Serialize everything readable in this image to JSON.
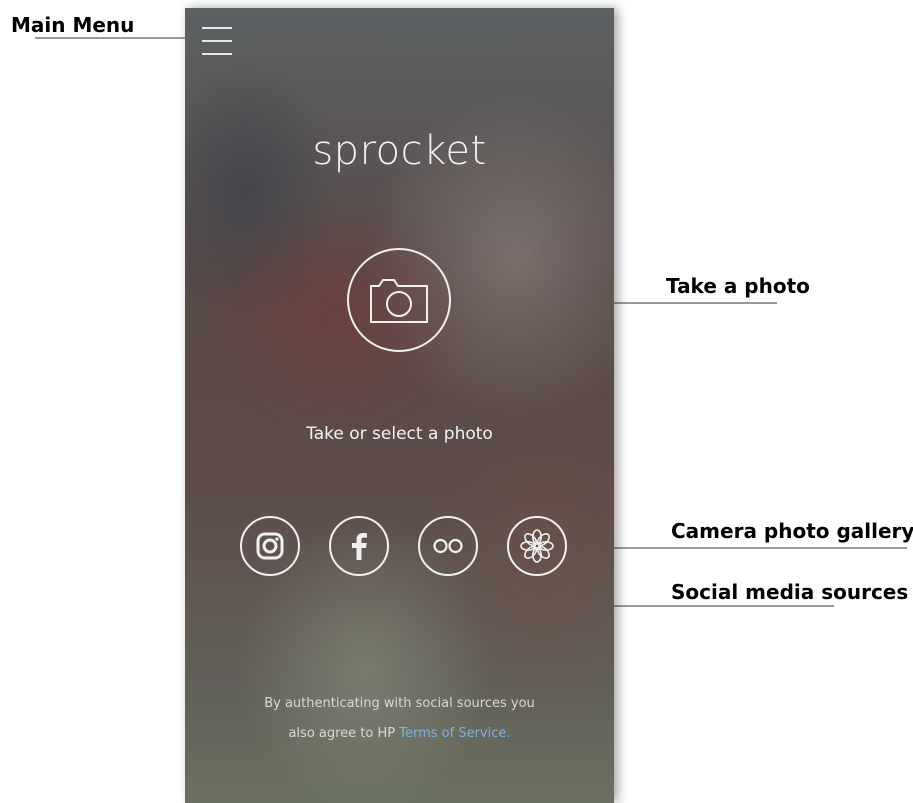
{
  "app": {
    "brand": "sprocket",
    "prompt": "Take or select a photo",
    "legal_line1": "By authenticating with social sources you",
    "legal_line2_prefix": "also agree to HP ",
    "legal_link": "Terms of Service."
  },
  "callouts": {
    "main_menu": "Main Menu",
    "take_photo": "Take a photo",
    "camera_gallery": "Camera photo gallery",
    "social_sources": "Social media sources"
  },
  "icons": {
    "menu": "hamburger-icon",
    "camera": "camera-icon",
    "instagram": "instagram-icon",
    "facebook": "facebook-icon",
    "flickr": "flickr-icon",
    "gallery": "flower-gallery-icon"
  },
  "colors": {
    "link": "#7fb3e0",
    "callout_line": "#9a9a9a"
  }
}
